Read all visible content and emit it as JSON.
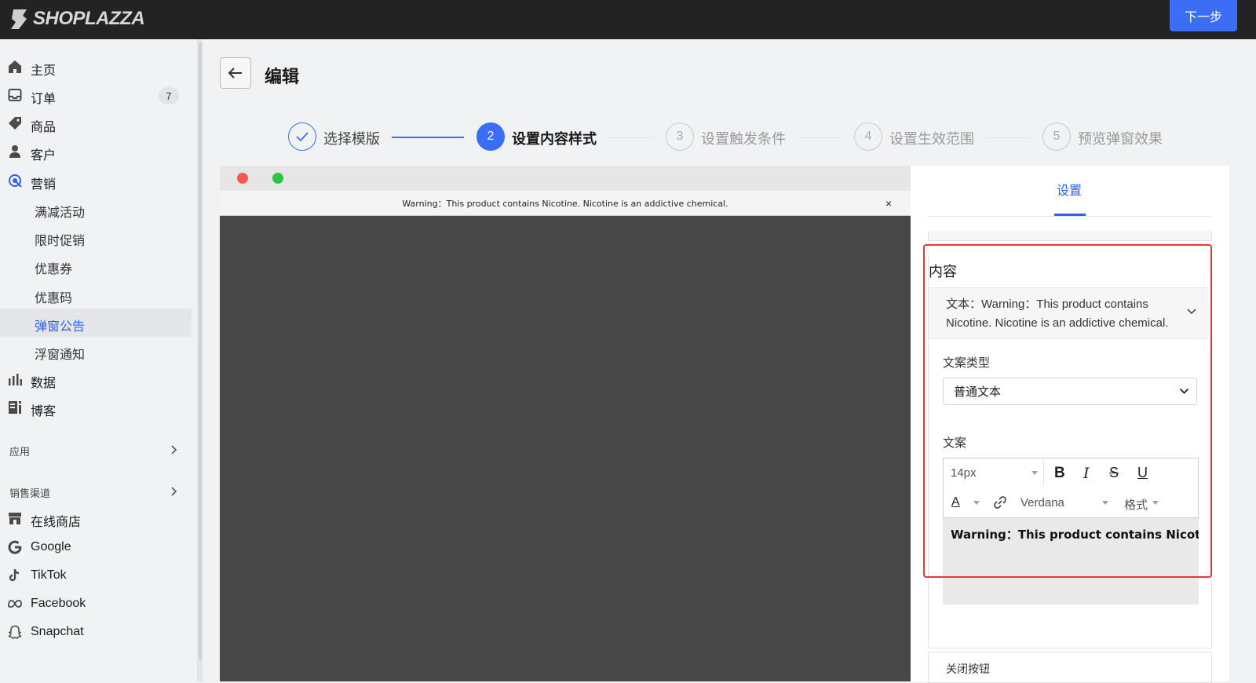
{
  "brand": {
    "name": "SHOPLAZZA"
  },
  "header": {
    "next_label": "下一步"
  },
  "sidebar": {
    "items": [
      {
        "label": "主页",
        "icon": "home-icon"
      },
      {
        "label": "订单",
        "icon": "inbox-icon",
        "badge": "7"
      },
      {
        "label": "商品",
        "icon": "tag-icon"
      },
      {
        "label": "客户",
        "icon": "person-icon"
      },
      {
        "label": "营销",
        "icon": "target-icon"
      }
    ],
    "marketing_sub": [
      "满减活动",
      "限时促销",
      "优惠券",
      "优惠码",
      "弹窗公告",
      "浮窗通知"
    ],
    "active_sub": "弹窗公告",
    "items2": [
      {
        "label": "数据",
        "icon": "bar-chart-icon"
      },
      {
        "label": "博客",
        "icon": "blog-icon"
      }
    ],
    "section_apps": "应用",
    "section_channels": "销售渠道",
    "channels": [
      {
        "label": "在线商店",
        "icon": "store-icon"
      },
      {
        "label": "Google",
        "icon": "google-icon"
      },
      {
        "label": "TikTok",
        "icon": "tiktok-icon"
      },
      {
        "label": "Facebook",
        "icon": "meta-icon"
      },
      {
        "label": "Snapchat",
        "icon": "snapchat-icon"
      }
    ]
  },
  "page": {
    "title": "编辑"
  },
  "steps": [
    {
      "number": "✓",
      "label": "选择模版",
      "state": "done"
    },
    {
      "number": "2",
      "label": "设置内容样式",
      "state": "current"
    },
    {
      "number": "3",
      "label": "设置触发条件",
      "state": "todo"
    },
    {
      "number": "4",
      "label": "设置生效范围",
      "state": "todo"
    },
    {
      "number": "5",
      "label": "预览弹窗效果",
      "state": "todo"
    }
  ],
  "preview": {
    "banner_text": "Warning：This product contains Nicotine. Nicotine is an addictive chemical.",
    "close_glyph": "×",
    "dot_colors": [
      "#f45b54",
      "#28c840"
    ]
  },
  "settings": {
    "tab_label": "设置",
    "content_title": "内容",
    "text_summary": "文本：Warning：This product contains Nicotine. Nicotine is an addictive chemical.",
    "copy_type_label": "文案类型",
    "copy_type_value": "普通文本",
    "copy_label": "文案",
    "editor": {
      "font_size": "14px",
      "bold": "B",
      "italic": "I",
      "strike": "S",
      "underline": "U",
      "color": "A",
      "font_family": "Verdana",
      "format": "格式",
      "body_text": "Warning：This product contains Nicotine. Nicotine is an addictive chemical."
    },
    "next_section_label": "关闭按钮"
  },
  "colors": {
    "accent": "#3b6ef5",
    "highlight": "#e53935",
    "topbar": "#232323"
  }
}
